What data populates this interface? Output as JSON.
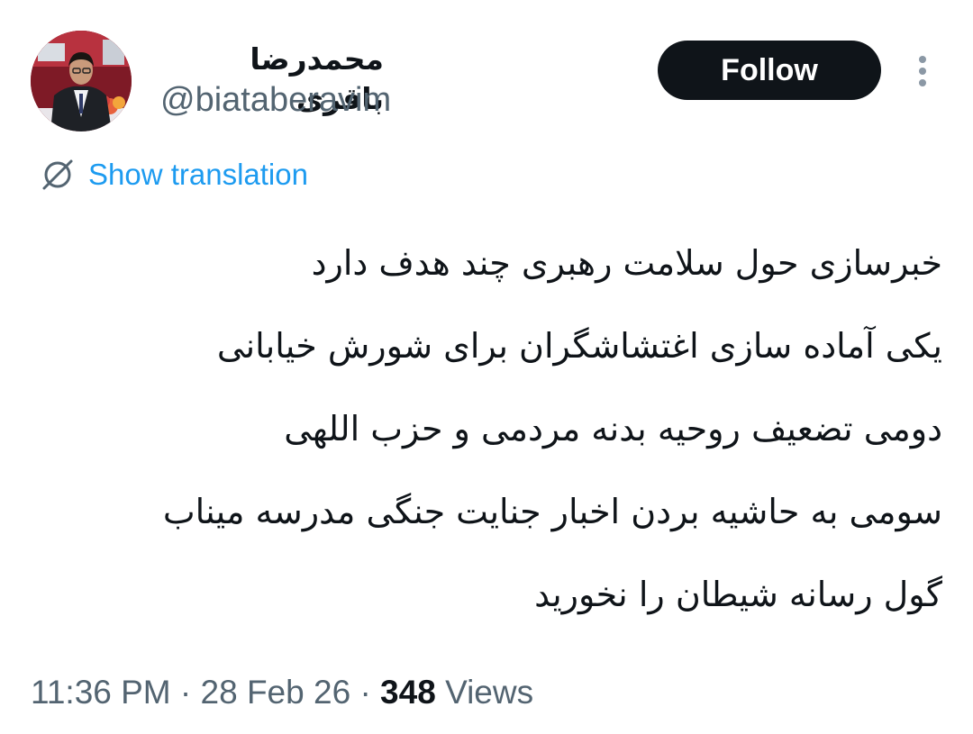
{
  "author": {
    "display_name": "محمدرضا باقری",
    "handle": "@biataberavim",
    "avatar_icon": "profile-photo"
  },
  "actions": {
    "follow_label": "Follow",
    "more_icon": "vertical-ellipsis-icon"
  },
  "translation": {
    "label": "Show translation",
    "icon": "translate-globe-icon"
  },
  "tweet": {
    "lines": [
      "خبرسازی حول سلامت رهبری چند هدف دارد",
      "یکی آماده سازی اغتشاشگران برای شورش خیابانی",
      "دومی تضعیف روحیه بدنه مردمی و حزب اللهی",
      "سومی به حاشیه بردن اخبار جنایت جنگی مدرسه میناب",
      "گول رسانه شیطان را نخورید"
    ]
  },
  "meta": {
    "time": "11:36 PM",
    "separator": "·",
    "date": "28 Feb 26",
    "views_count": "348",
    "views_label": "Views"
  },
  "colors": {
    "text_primary": "#0f1419",
    "text_secondary": "#536471",
    "link": "#1d9bf0",
    "follow_bg": "#0f1419"
  }
}
